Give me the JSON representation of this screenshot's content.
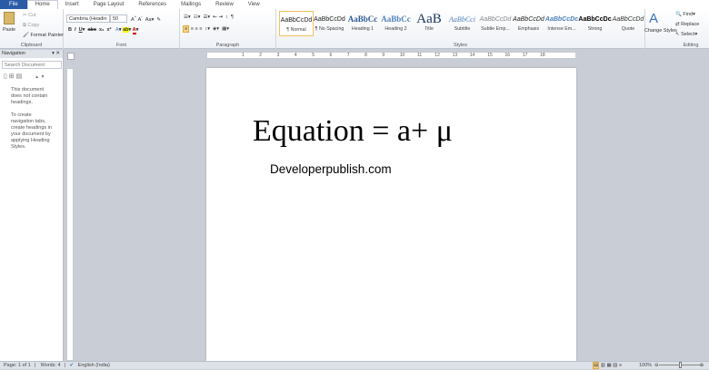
{
  "tabs": [
    "File",
    "Home",
    "Insert",
    "Page Layout",
    "References",
    "Mailings",
    "Review",
    "View"
  ],
  "clipboard": {
    "paste": "Paste",
    "cut": "Cut",
    "copy": "Copy",
    "format_painter": "Format Painter",
    "label": "Clipboard"
  },
  "font": {
    "name": "Cambria (Headin",
    "size": "50",
    "label": "Font"
  },
  "paragraph": {
    "label": "Paragraph"
  },
  "styles": {
    "items": [
      "¶ Normal",
      "¶ No Spacing",
      "Heading 1",
      "Heading 2",
      "Title",
      "Subtitle",
      "Subtle Emp...",
      "Emphasis",
      "Intense Em...",
      "Strong",
      "Quote"
    ],
    "preview": [
      "AaBbCcDd",
      "AaBbCcDd",
      "AaBbCc",
      "AaBbCc",
      "AaB",
      "AaBbCci",
      "AaBbCcDd",
      "AaBbCcDd",
      "AaBbCcDc",
      "AaBbCcDc",
      "AaBbCcDd"
    ],
    "change": "Change Styles",
    "label": "Styles"
  },
  "editing": {
    "find": "Find",
    "replace": "Replace",
    "select": "Select",
    "label": "Editing"
  },
  "navigation": {
    "title": "Navigation",
    "search_placeholder": "Search Document",
    "msg1": "This document does not contain headings.",
    "msg2": "To create navigation tabs, create headings in your document by applying Heading Styles."
  },
  "ruler": [
    "1",
    "2",
    "3",
    "4",
    "5",
    "6",
    "7",
    "8",
    "9",
    "10",
    "11",
    "12",
    "13",
    "14",
    "15",
    "16",
    "17",
    "18"
  ],
  "document": {
    "equation": "Equation = a+ μ",
    "website": "Developerpublish.com"
  },
  "status": {
    "page": "Page: 1 of 1",
    "words": "Words: 4",
    "language": "English (India)",
    "zoom": "100%"
  },
  "colors": {
    "file_tab": "#2a5ba6",
    "selected_style": "#f1c15f"
  }
}
